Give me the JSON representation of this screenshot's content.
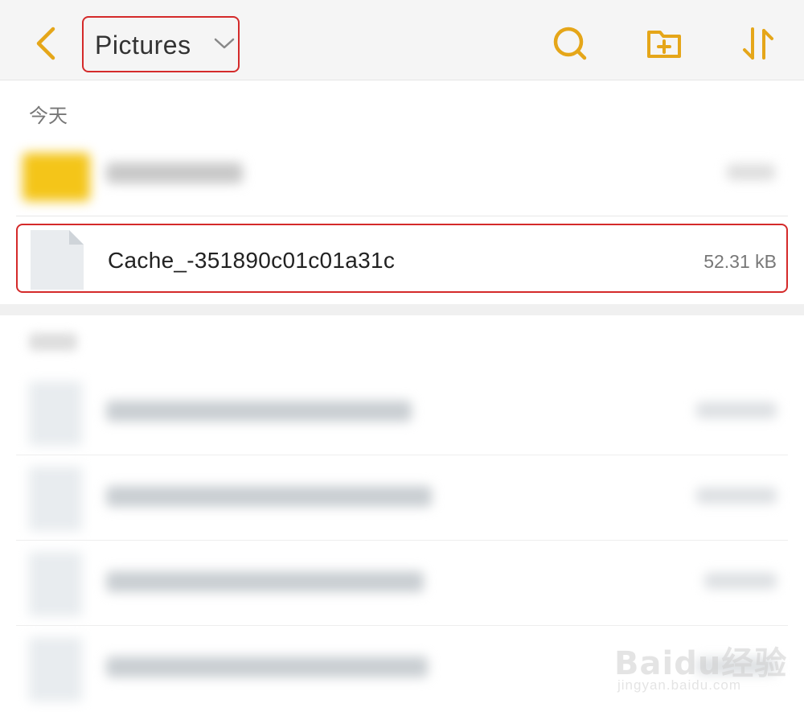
{
  "header": {
    "folder_title": "Pictures",
    "back_icon": "chevron-left-icon",
    "dropdown_icon": "chevron-down-icon",
    "search_icon": "search-icon",
    "new_folder_icon": "folder-plus-icon",
    "sort_icon": "sort-icon",
    "accent_color": "#E5A619"
  },
  "sections": {
    "today_label": "今天"
  },
  "files": {
    "highlighted": {
      "name": "Cache_-351890c01c01a31c",
      "size": "52.31 kB",
      "icon": "document-icon"
    }
  },
  "watermark": {
    "brand": "Baidu经验",
    "url": "jingyan.baidu.com"
  }
}
